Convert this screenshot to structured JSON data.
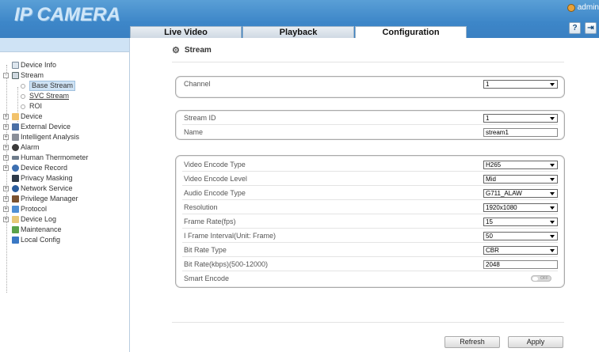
{
  "header": {
    "logo": "IP CAMERA",
    "user": "admin",
    "tabs": [
      {
        "label": "Live Video"
      },
      {
        "label": "Playback"
      },
      {
        "label": "Configuration"
      }
    ],
    "help_icon": "?",
    "logout_icon": "⇥"
  },
  "sidebar": {
    "items": [
      {
        "label": "Device Info"
      },
      {
        "label": "Stream"
      },
      {
        "label": "Base Stream"
      },
      {
        "label": "SVC Stream"
      },
      {
        "label": "ROI"
      },
      {
        "label": "Device"
      },
      {
        "label": "External Device"
      },
      {
        "label": "Intelligent Analysis"
      },
      {
        "label": "Alarm"
      },
      {
        "label": "Human Thermometer"
      },
      {
        "label": "Device Record"
      },
      {
        "label": "Privacy Masking"
      },
      {
        "label": "Network Service"
      },
      {
        "label": "Privilege Manager"
      },
      {
        "label": "Protocol"
      },
      {
        "label": "Device Log"
      },
      {
        "label": "Maintenance"
      },
      {
        "label": "Local Config"
      }
    ]
  },
  "main": {
    "title": "Stream",
    "channel": {
      "label": "Channel",
      "value": "1"
    },
    "stream_id": {
      "label": "Stream ID",
      "value": "1"
    },
    "name": {
      "label": "Name",
      "value": "stream1"
    },
    "settings": [
      {
        "label": "Video Encode Type",
        "value": "H265",
        "kind": "select"
      },
      {
        "label": "Video Encode Level",
        "value": "Mid",
        "kind": "select"
      },
      {
        "label": "Audio Encode Type",
        "value": "G711_ALAW",
        "kind": "select"
      },
      {
        "label": "Resolution",
        "value": "1920x1080",
        "kind": "select"
      },
      {
        "label": "Frame Rate(fps)",
        "value": "15",
        "kind": "select"
      },
      {
        "label": "I Frame Interval(Unit: Frame)",
        "value": "50",
        "kind": "select"
      },
      {
        "label": "Bit Rate Type",
        "value": "CBR",
        "kind": "select"
      },
      {
        "label": "Bit Rate(kbps)(500-12000)",
        "value": "2048",
        "kind": "input"
      },
      {
        "label": "Smart Encode",
        "value": "OFF",
        "kind": "toggle"
      }
    ],
    "refresh_label": "Refresh",
    "apply_label": "Apply"
  }
}
